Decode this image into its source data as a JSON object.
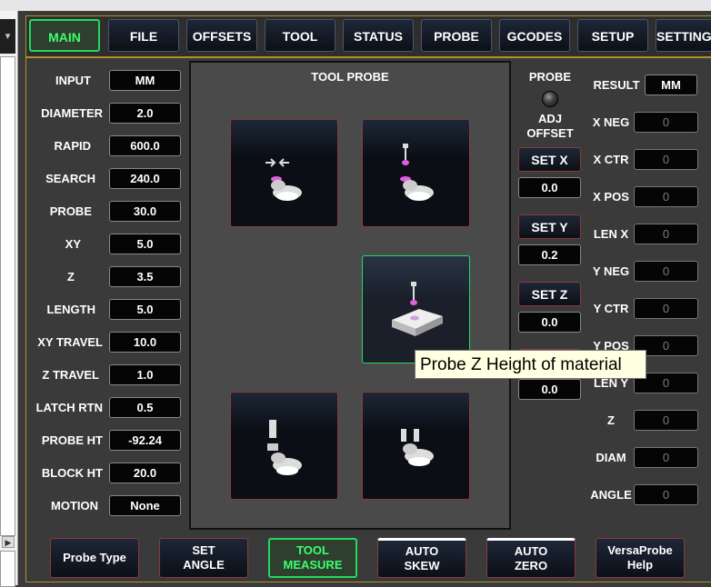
{
  "tabs": [
    "MAIN",
    "FILE",
    "OFFSETS",
    "TOOL",
    "STATUS",
    "PROBE",
    "GCODES",
    "SETUP",
    "SETTINGS"
  ],
  "active_tab": "MAIN",
  "left_fields": [
    {
      "label": "INPUT",
      "value": "MM"
    },
    {
      "label": "DIAMETER",
      "value": "2.0"
    },
    {
      "label": "RAPID",
      "value": "600.0"
    },
    {
      "label": "SEARCH",
      "value": "240.0"
    },
    {
      "label": "PROBE",
      "value": "30.0"
    },
    {
      "label": "XY",
      "value": "5.0"
    },
    {
      "label": "Z",
      "value": "3.5"
    },
    {
      "label": "LENGTH",
      "value": "5.0"
    },
    {
      "label": "XY TRAVEL",
      "value": "10.0"
    },
    {
      "label": "Z TRAVEL",
      "value": "1.0"
    },
    {
      "label": "LATCH RTN",
      "value": "0.5"
    },
    {
      "label": "PROBE HT",
      "value": "-92.24"
    },
    {
      "label": "BLOCK HT",
      "value": "20.0"
    },
    {
      "label": "MOTION",
      "value": "None"
    }
  ],
  "probe_panel": {
    "title": "TOOL PROBE"
  },
  "center": {
    "probe_label": "PROBE",
    "adj_label": "ADJ",
    "offset_label": "OFFSET",
    "set_x": "SET  X",
    "set_x_value": "0.0",
    "set_y": "SET  Y",
    "set_y_value": "0.2",
    "set_z": "SET  Z",
    "set_z_value": "0.0",
    "fourth_value": "0.0"
  },
  "result": {
    "label": "RESULT",
    "unit": "MM",
    "rows": [
      {
        "label": "X NEG",
        "value": "0"
      },
      {
        "label": "X CTR",
        "value": "0"
      },
      {
        "label": "X POS",
        "value": "0"
      },
      {
        "label": "LEN X",
        "value": "0"
      },
      {
        "label": "Y NEG",
        "value": "0"
      },
      {
        "label": "Y CTR",
        "value": "0"
      },
      {
        "label": "Y POS",
        "value": "0"
      },
      {
        "label": "LEN Y",
        "value": "0"
      },
      {
        "label": "Z",
        "value": "0"
      },
      {
        "label": "DIAM",
        "value": "0"
      },
      {
        "label": "ANGLE",
        "value": "0"
      }
    ]
  },
  "bottom_buttons": [
    {
      "line1": "Probe Type",
      "line2": ""
    },
    {
      "line1": "SET",
      "line2": "ANGLE"
    },
    {
      "line1": "TOOL",
      "line2": "MEASURE"
    },
    {
      "line1": "AUTO",
      "line2": "SKEW"
    },
    {
      "line1": "AUTO",
      "line2": "ZERO"
    },
    {
      "line1": "VersaProbe",
      "line2": "Help"
    }
  ],
  "tooltip": "Probe Z Height of material",
  "colors": {
    "accent_green": "#22d95f",
    "border_gold": "#b0902a",
    "button_red_border": "#8a3a3a"
  }
}
